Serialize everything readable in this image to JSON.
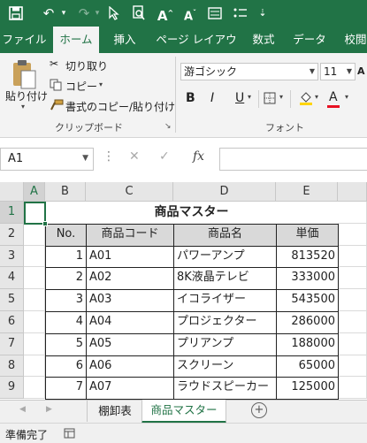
{
  "qat": {
    "save_icon": "save-icon",
    "undo_icon": "undo-icon",
    "redo_icon": "redo-icon",
    "pointer_icon": "pointer-icon",
    "preview_icon": "print-preview-icon",
    "font_up_label": "A",
    "font_down_label": "A"
  },
  "tabs": [
    "ファイル",
    "ホーム",
    "挿入",
    "ページ レイアウト",
    "数式",
    "データ",
    "校閲"
  ],
  "active_tab": 1,
  "ribbon": {
    "paste_label": "貼り付け",
    "cut_label": "切り取り",
    "copy_label": "コピー",
    "format_painter_label": "書式のコピー/貼り付け",
    "clipboard_group": "クリップボード",
    "font_name": "游ゴシック",
    "font_size": "11",
    "font_group": "フォント",
    "bold_label": "B",
    "italic_label": "I",
    "underline_label": "U",
    "font_color_label": "A",
    "font_color": "#e81123"
  },
  "formula_bar": {
    "name_box": "A1",
    "cancel_glyph": "✕",
    "enter_glyph": "✓",
    "fx_label": "fx",
    "content": ""
  },
  "grid": {
    "columns": [
      "A",
      "B",
      "C",
      "D",
      "E"
    ],
    "rows": [
      "1",
      "2",
      "3",
      "4",
      "5",
      "6",
      "7",
      "8",
      "9"
    ],
    "title": "商品マスター",
    "headers": [
      "No.",
      "商品コード",
      "商品名",
      "単価"
    ],
    "data": [
      [
        "1",
        "A01",
        "パワーアンプ",
        "813520"
      ],
      [
        "2",
        "A02",
        "8K液晶テレビ",
        "333000"
      ],
      [
        "3",
        "A03",
        "イコライザー",
        "543500"
      ],
      [
        "4",
        "A04",
        "プロジェクター",
        "286000"
      ],
      [
        "5",
        "A05",
        "プリアンプ",
        "188000"
      ],
      [
        "6",
        "A06",
        "スクリーン",
        "65000"
      ],
      [
        "7",
        "A07",
        "ラウドスピーカー",
        "125000"
      ]
    ]
  },
  "sheets": [
    "棚卸表",
    "商品マスター"
  ],
  "active_sheet": 1,
  "status": {
    "ready": "準備完了"
  },
  "colors": {
    "brand": "#217346",
    "ribbon_bg": "#f3f3f3",
    "header_fill": "#d9d9d9"
  }
}
